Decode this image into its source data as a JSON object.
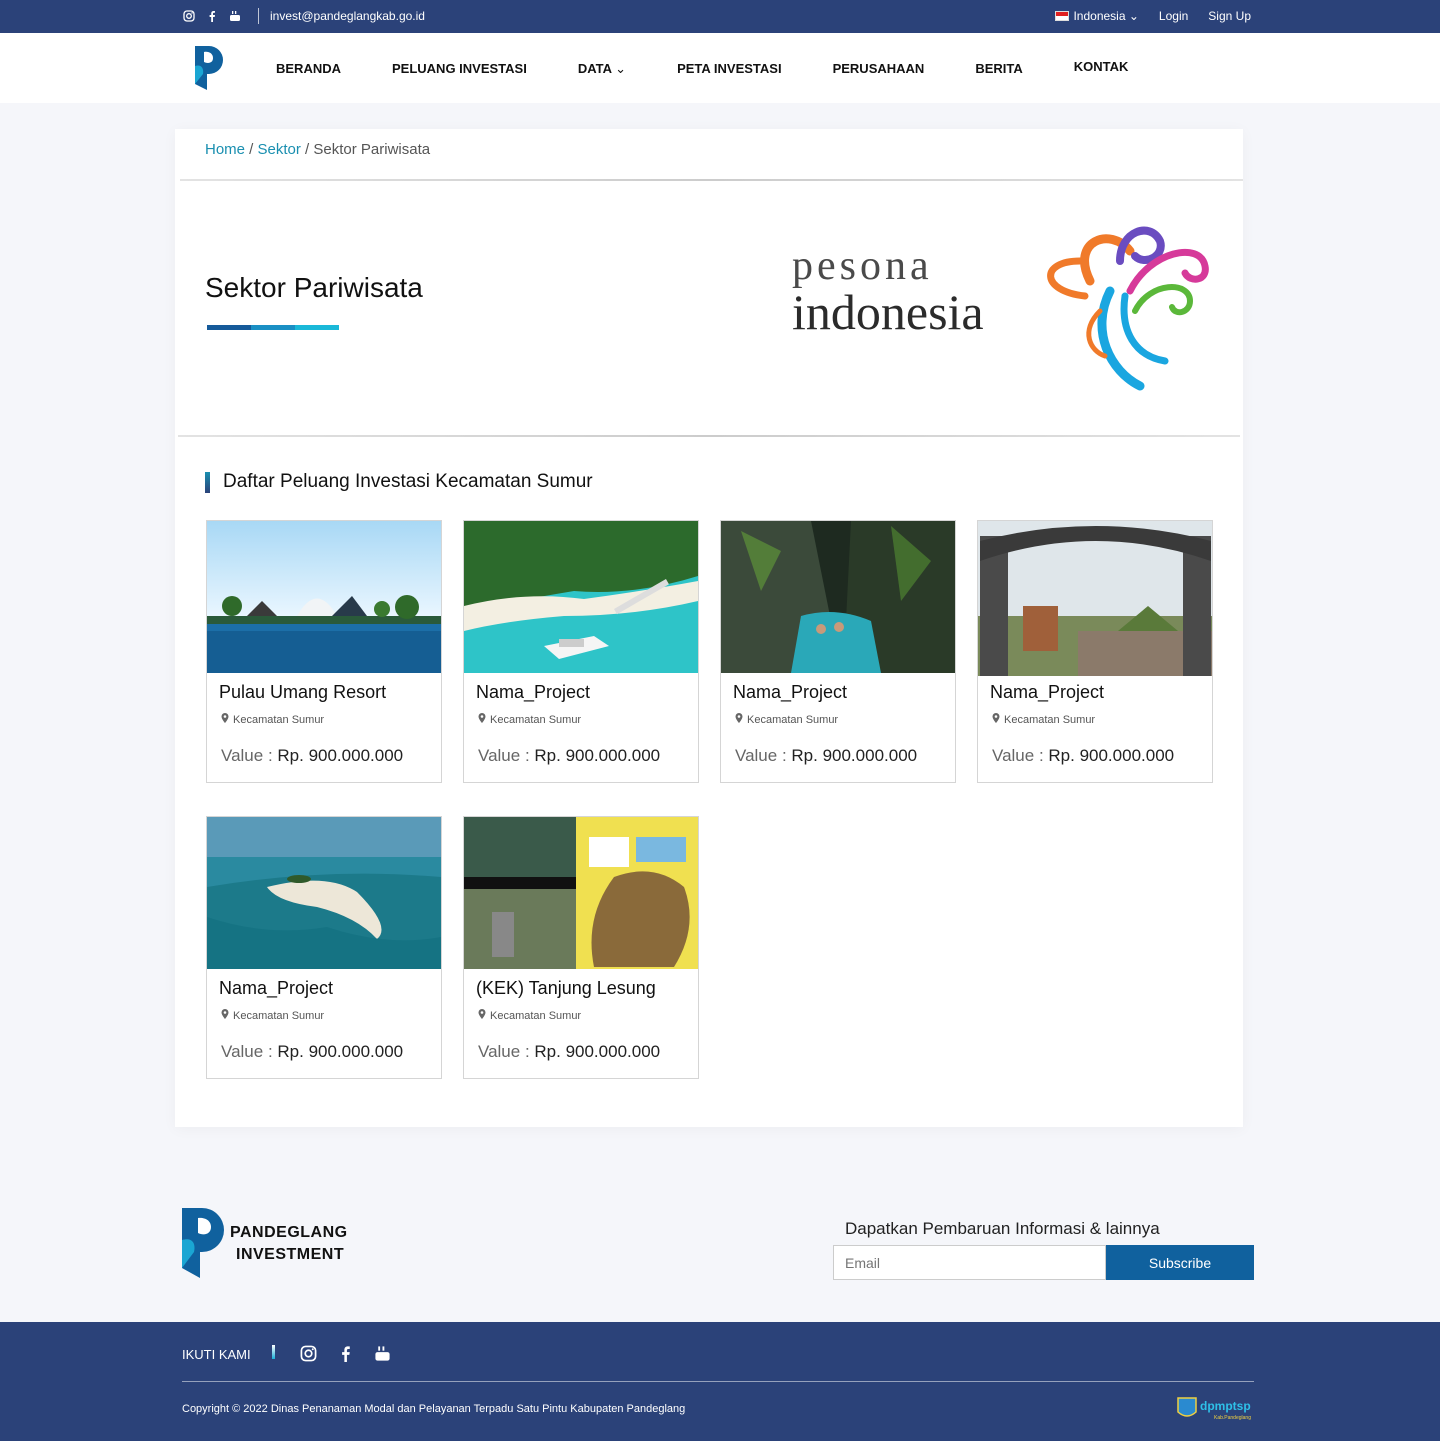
{
  "topbar": {
    "email": "invest@pandeglangkab.go.id",
    "language": "Indonesia",
    "login": "Login",
    "signup": "Sign Up"
  },
  "nav": {
    "items": [
      "BERANDA",
      "PELUANG INVESTASI",
      "DATA",
      "PETA INVESTASI",
      "PERUSAHAAN",
      "BERITA",
      "KONTAK"
    ]
  },
  "breadcrumb": {
    "home": "Home",
    "sektor": "Sektor",
    "current": "Sektor Pariwisata"
  },
  "sector": {
    "title": "Sektor Pariwisata",
    "logo_line1": "pesona",
    "logo_line2": "indonesia",
    "underline_colors": [
      "#155a9a",
      "#1a8fc4",
      "#1ab8d8"
    ]
  },
  "list": {
    "heading": "Daftar Peluang Investasi Kecamatan Sumur",
    "value_label": "Value : ",
    "projects": [
      {
        "name": "Pulau Umang Resort",
        "location": "Kecamatan Sumur",
        "value": "Rp. 900.000.000"
      },
      {
        "name": "Nama_Project",
        "location": "Kecamatan Sumur",
        "value": "Rp. 900.000.000"
      },
      {
        "name": "Nama_Project",
        "location": "Kecamatan Sumur",
        "value": "Rp. 900.000.000"
      },
      {
        "name": "Nama_Project",
        "location": "Kecamatan Sumur",
        "value": "Rp. 900.000.000"
      },
      {
        "name": "Nama_Project",
        "location": "Kecamatan Sumur",
        "value": "Rp. 900.000.000"
      },
      {
        "name": "(KEK) Tanjung Lesung",
        "location": "Kecamatan Sumur",
        "value": "Rp. 900.000.000"
      }
    ]
  },
  "footer": {
    "logo_line1": "PANDEGLANG",
    "logo_line2": "INVESTMENT",
    "subscribe_title": "Dapatkan Pembaruan Informasi & lainnya",
    "email_placeholder": "Email",
    "subscribe_button": "Subscribe",
    "follow": "IKUTI KAMI",
    "copyright": "Copyright © 2022 Dinas Penanaman Modal dan Pelayanan Terpadu Satu Pintu Kabupaten Pandeglang",
    "dpmptsp": "dpmptsp",
    "dpmptsp_sub": "Kab.Pandeglang"
  },
  "colors": {
    "navy": "#2b4279",
    "accent": "#1a8fb0",
    "button": "#10619e"
  }
}
